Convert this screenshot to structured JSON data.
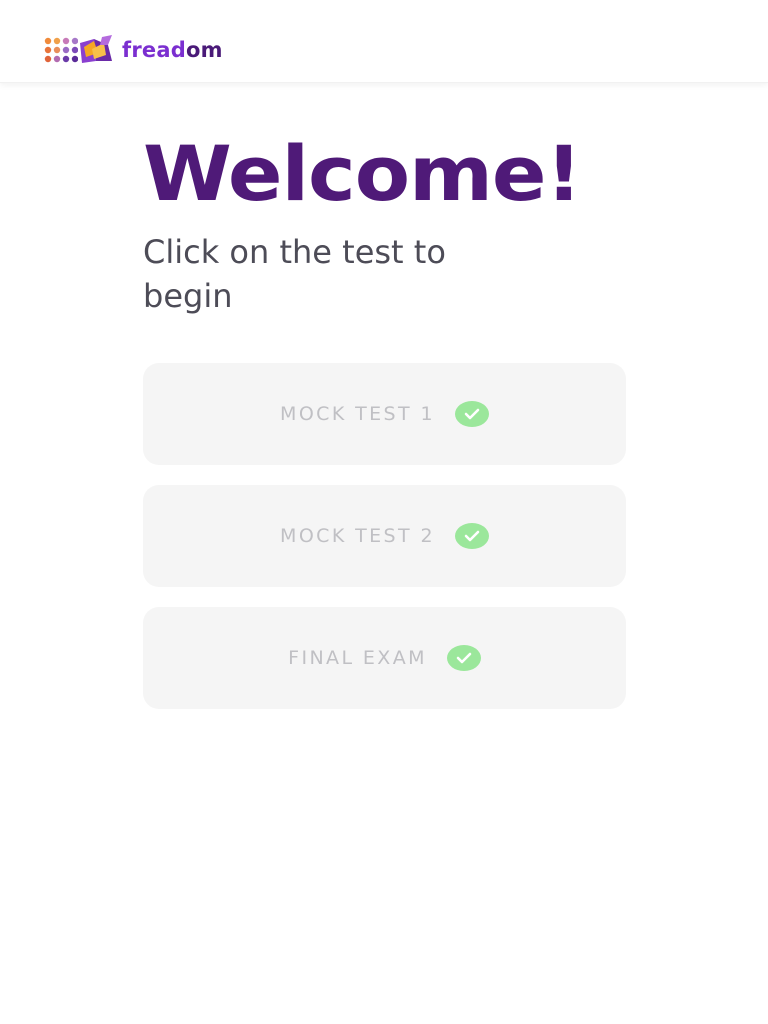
{
  "header": {
    "brand_part1": "fread",
    "brand_part2": "om"
  },
  "main": {
    "title": "Welcome!",
    "subtitle": "Click on the test to begin"
  },
  "tests": [
    {
      "label": "MOCK TEST 1",
      "status": "completed",
      "icon": "check-circle-icon"
    },
    {
      "label": "MOCK TEST 2",
      "status": "completed",
      "icon": "check-circle-icon"
    },
    {
      "label": "FINAL EXAM",
      "status": "completed",
      "icon": "check-circle-icon"
    }
  ],
  "colors": {
    "brand_purple": "#4f1a78",
    "brand_violet": "#7b2fd0",
    "check_green": "#9be79b",
    "card_bg": "#f5f5f5",
    "label_gray": "#c0c0c4"
  }
}
